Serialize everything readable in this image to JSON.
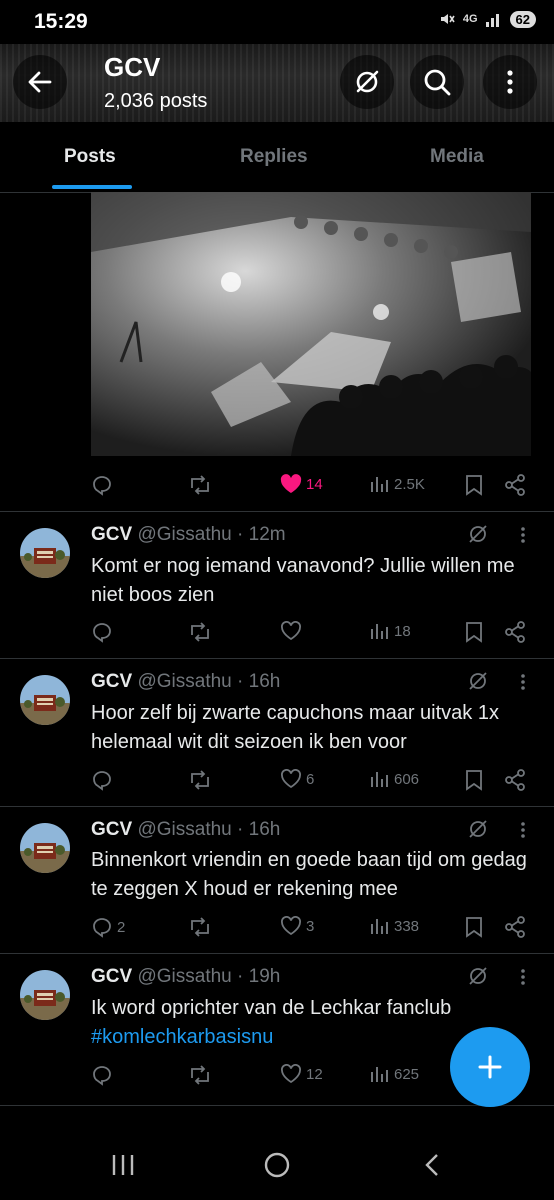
{
  "status_bar": {
    "time": "15:29",
    "network": "4G",
    "battery": "62"
  },
  "header": {
    "name": "GCV",
    "post_count": "2,036 posts"
  },
  "tabs": [
    {
      "label": "Posts",
      "active": true
    },
    {
      "label": "Replies"
    },
    {
      "label": "Media"
    }
  ],
  "first_post_actions": {
    "replies": "",
    "reposts": "",
    "likes": "14",
    "views": "2.5K",
    "liked": true
  },
  "tweets": [
    {
      "name": "GCV",
      "handle": "@Gissathu",
      "time": "12m",
      "text": "Komt er nog iemand vanavond? Jullie willen me niet boos zien",
      "replies": "",
      "reposts": "",
      "likes": "",
      "views": "18"
    },
    {
      "name": "GCV",
      "handle": "@Gissathu",
      "time": "16h",
      "text": "Hoor zelf bij zwarte capuchons maar uitvak 1x helemaal wit dit seizoen ik ben voor",
      "replies": "",
      "reposts": "",
      "likes": "6",
      "views": "606"
    },
    {
      "name": "GCV",
      "handle": "@Gissathu",
      "time": "16h",
      "text": "Binnenkort vriendin en goede baan tijd om gedag te zeggen X houd er rekening mee",
      "replies": "2",
      "reposts": "",
      "likes": "3",
      "views": "338"
    },
    {
      "name": "GCV",
      "handle": "@Gissathu",
      "time": "19h",
      "text": "Ik word oprichter van de Lechkar fanclub",
      "hashtag": "#komlechkarbasisnu",
      "replies": "",
      "reposts": "",
      "likes": "12",
      "views": "625"
    }
  ],
  "colors": {
    "accent": "#1d9bf0",
    "like": "#f91880",
    "muted": "#71767b",
    "text": "#e7e9ea"
  },
  "icons": {
    "back": "arrow-left-icon",
    "grok": "grok-icon",
    "search": "search-icon",
    "more": "more-vertical-icon",
    "reply": "reply-icon",
    "repost": "repost-icon",
    "like": "heart-icon",
    "views": "views-icon",
    "bookmark": "bookmark-icon",
    "share": "share-icon",
    "compose": "plus-icon"
  }
}
